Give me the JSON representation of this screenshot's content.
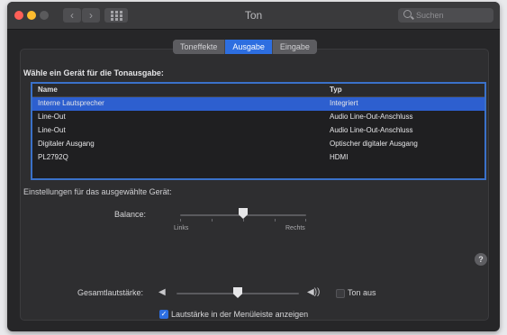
{
  "window": {
    "title": "Ton"
  },
  "toolbar": {
    "back_glyph": "‹",
    "forward_glyph": "›",
    "search_placeholder": "Suchen"
  },
  "tabs": [
    {
      "label": "Toneffekte",
      "active": false
    },
    {
      "label": "Ausgabe",
      "active": true
    },
    {
      "label": "Eingabe",
      "active": false
    }
  ],
  "output": {
    "heading": "Wähle ein Gerät für die Tonausgabe:",
    "columns": {
      "name": "Name",
      "type": "Typ"
    },
    "devices": [
      {
        "name": "Interne Lautsprecher",
        "type": "Integriert",
        "selected": true
      },
      {
        "name": "Line-Out",
        "type": "Audio Line-Out-Anschluss",
        "selected": false
      },
      {
        "name": "Line-Out",
        "type": "Audio Line-Out-Anschluss",
        "selected": false
      },
      {
        "name": "Digitaler Ausgang",
        "type": "Optischer digitaler Ausgang",
        "selected": false
      },
      {
        "name": "PL2792Q",
        "type": "HDMI",
        "selected": false
      }
    ]
  },
  "device_settings": {
    "label": "Einstellungen für das ausgewählte Gerät:",
    "balance": {
      "label": "Balance:",
      "left": "Links",
      "right": "Rechts",
      "value": 0.5
    }
  },
  "help": {
    "glyph": "?"
  },
  "volume": {
    "label": "Gesamtlautstärke:",
    "value": 0.5,
    "low_icon_glyph": "◀",
    "high_icon_glyph": "◀))",
    "mute": {
      "label": "Ton aus",
      "checked": false
    },
    "menubar": {
      "label": "Lautstärke in der Menüleiste anzeigen",
      "checked": true
    }
  },
  "colors": {
    "accent": "#2d6ee0",
    "selection": "#2d5fcf",
    "background": "#262628"
  },
  "icons": [
    "close-icon",
    "minimize-icon",
    "zoom-icon",
    "grid-icon",
    "search-icon",
    "help-icon",
    "speaker-low-icon",
    "speaker-high-icon",
    "checkmark-icon"
  ]
}
